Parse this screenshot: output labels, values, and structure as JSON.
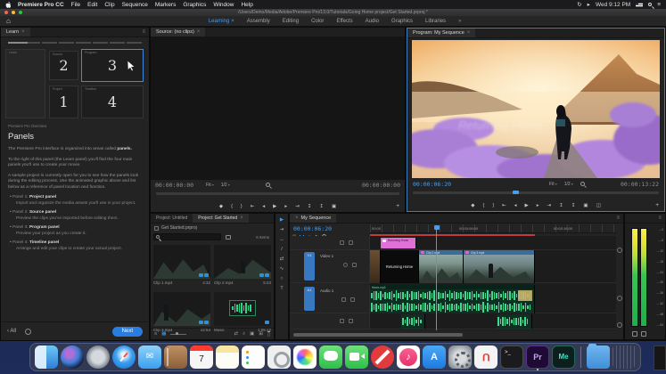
{
  "menubar": {
    "app_name": "Premiere Pro CC",
    "items": [
      "File",
      "Edit",
      "Clip",
      "Sequence",
      "Markers",
      "Graphics",
      "Window",
      "Help"
    ],
    "clock": "Wed 9:12 PM"
  },
  "titlebar": {
    "document_path": "/Users/Demo/Media/Adobe/Premiere Pro/13.0/Tutorials/Going Home project/Get Started.prproj *"
  },
  "workspaces": {
    "tabs": [
      "Learning",
      "Assembly",
      "Editing",
      "Color",
      "Effects",
      "Audio",
      "Graphics",
      "Libraries"
    ],
    "overflow": "»"
  },
  "learn": {
    "tab": "Learn",
    "diagram": {
      "side_label": "Learn",
      "boxes": [
        {
          "num": "2",
          "label": "Source"
        },
        {
          "num": "3",
          "label": "Program"
        },
        {
          "num": "1",
          "label": "Project"
        },
        {
          "num": "4",
          "label": "Timeline"
        }
      ]
    },
    "kicker": "Premiere Pro Overview",
    "title": "Panels",
    "p1": "The Premiere Pro interface is organized into areas called",
    "p1_bold": "panels.",
    "p2": "To the right of this panel (the Learn panel) you'll find the four main panels you'll use to create your movie.",
    "p3": "A sample project is currently open for you to see how the panels look during the editing process. Use the animated graphic above and list below as a reference of panel location and function.",
    "bullets": [
      {
        "prefix": "Panel 1:",
        "name": "Project panel",
        "desc": "Import and organize the media assets you'll use in your project."
      },
      {
        "prefix": "Panel 2:",
        "name": "Source panel",
        "desc": "Preview the clips you've imported before editing them."
      },
      {
        "prefix": "Panel 3:",
        "name": "Program panel",
        "desc": "Preview your project as you create it."
      },
      {
        "prefix": "Panel 4:",
        "name": "Timeline panel",
        "desc": "Arrange and edit your clips to create your actual project."
      }
    ],
    "footer": {
      "all_label": "All",
      "next_label": "Next"
    }
  },
  "source": {
    "tab": "Source: (no clips)",
    "tc_left": "00:00:00:00",
    "fit": "Fit",
    "scale": "1/2",
    "tc_right": "00:00:00:00",
    "transport": [
      {
        "name": "add-marker",
        "glyph": "◆"
      },
      {
        "name": "mark-in",
        "glyph": "{"
      },
      {
        "name": "mark-out",
        "glyph": "}"
      },
      {
        "name": "go-to-in",
        "glyph": "⇤"
      },
      {
        "name": "step-back",
        "glyph": "◂"
      },
      {
        "name": "play",
        "glyph": "▶"
      },
      {
        "name": "step-forward",
        "glyph": "▸"
      },
      {
        "name": "go-to-out",
        "glyph": "⇥"
      },
      {
        "name": "insert",
        "glyph": "↧"
      },
      {
        "name": "overwrite",
        "glyph": "↥"
      },
      {
        "name": "export-frame",
        "glyph": "▣"
      }
    ],
    "plus": "+"
  },
  "program": {
    "tab": "Program: My Sequence",
    "tc_current": "00:00:06:20",
    "fit": "Fit",
    "scale": "1/2",
    "tc_duration": "00:00:13:22",
    "overlay_title": "Returning Home",
    "transport": [
      {
        "name": "add-marker",
        "glyph": "◆"
      },
      {
        "name": "mark-in",
        "glyph": "{"
      },
      {
        "name": "mark-out",
        "glyph": "}"
      },
      {
        "name": "go-to-in",
        "glyph": "⇤"
      },
      {
        "name": "step-back",
        "glyph": "◂"
      },
      {
        "name": "play",
        "glyph": "▶"
      },
      {
        "name": "step-forward",
        "glyph": "▸"
      },
      {
        "name": "go-to-out",
        "glyph": "⇥"
      },
      {
        "name": "lift",
        "glyph": "↥"
      },
      {
        "name": "extract",
        "glyph": "↧"
      },
      {
        "name": "export-frame",
        "glyph": "▣"
      },
      {
        "name": "comparison-view",
        "glyph": "◫"
      }
    ],
    "plus": "+"
  },
  "project": {
    "tab_inactive": "Project: Untitled",
    "tab_active": "Project: Get Started",
    "bin_path": "Get Started.prproj",
    "items_count": "6 Items",
    "clips": [
      {
        "name": "Clip 1.mp4",
        "duration": "4:32",
        "type": "video"
      },
      {
        "name": "Clip 2.mp4",
        "duration": "5:23",
        "type": "video"
      },
      {
        "name": "Clip 3.mp4",
        "duration": "12:54",
        "type": "video"
      },
      {
        "name": "Music",
        "duration": "1:05:12",
        "type": "audio"
      }
    ]
  },
  "tools": [
    "selection",
    "track-select-forward",
    "ripple-edit",
    "razor",
    "slip",
    "pen",
    "hand",
    "type"
  ],
  "timeline": {
    "tab": "My Sequence",
    "tc": "00:00:06:20",
    "ruler": [
      "00:00",
      "00:00:08:00",
      "00:00:16:00"
    ],
    "tracks": {
      "v2": {
        "id": "V2",
        "clip": "Returning Home"
      },
      "v1": {
        "id": "V1",
        "name": "Video 1",
        "title_clip": "Returning Home",
        "clip2": "Clip 2.mp4",
        "clip3": "Clip 3.mp4"
      },
      "a1": {
        "id": "A1",
        "name": "Audio 1",
        "clip": "Music.mp3"
      },
      "a2": {
        "id": "A2"
      }
    }
  },
  "meters": {
    "db": [
      "0",
      "-6",
      "-12",
      "-18",
      "-24",
      "-30",
      "-36",
      "-42",
      "-48",
      "-54"
    ]
  },
  "dock": [
    "finder",
    "siri",
    "launchpad",
    "safari",
    "mail",
    "contacts",
    "calendar",
    "notes",
    "reminders",
    "keychain-access",
    "photos",
    "messages",
    "facetime",
    "restricted-app",
    "music",
    "app-store",
    "system-preferences",
    "magnet",
    "terminal",
    "premiere-pro",
    "media-encoder",
    "downloads",
    "trash"
  ],
  "dock_glyphs": {
    "calendar_day": "7",
    "mail": "✉",
    "music": "♪",
    "app_store": "A",
    "magnet": "U",
    "terminal": ">_",
    "premiere": "Pr",
    "media_encoder": "Me"
  },
  "colors": {
    "accent_blue": "#2f7fe0",
    "timecode_blue": "#43a0f2",
    "waveform_green": "#3fd98f",
    "render_bar_red": "#c03a3a",
    "graphic_clip_pink": "#d76cc3",
    "meter_green": "#27c24c",
    "meter_yellow": "#ece43a",
    "next_button_blue": "#2a7de0"
  }
}
